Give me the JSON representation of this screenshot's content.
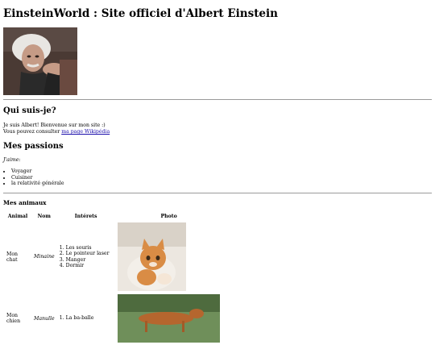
{
  "page": {
    "title": "EinsteinWorld : Site officiel d'Albert Einstein"
  },
  "about": {
    "heading": "Qui suis-je?",
    "line1": "Je suis Albert! Bienvenue sur mon site :)",
    "line2_prefix": "Vous pouvez consulter ",
    "link_text": "ma page Wikipédia"
  },
  "passions": {
    "heading": "Mes passions",
    "intro": "J'aime:",
    "items": [
      "Voyager",
      "Cuisiner",
      "la relativité générale"
    ]
  },
  "animals": {
    "heading": "Mes animaux",
    "columns": [
      "Animal",
      "Nom",
      "Intérets",
      "Photo"
    ],
    "rows": [
      {
        "animal": "Mon chat",
        "name": "Minaine",
        "interests": [
          "Les souris",
          "Le pointeur laser",
          "Manger",
          "Dormir"
        ]
      },
      {
        "animal": "Mon chien",
        "name": "Manulle",
        "interests": [
          "La ba-balle"
        ]
      }
    ]
  },
  "colors": {
    "link": "#1a0dab",
    "rule": "#9a9a9a"
  }
}
